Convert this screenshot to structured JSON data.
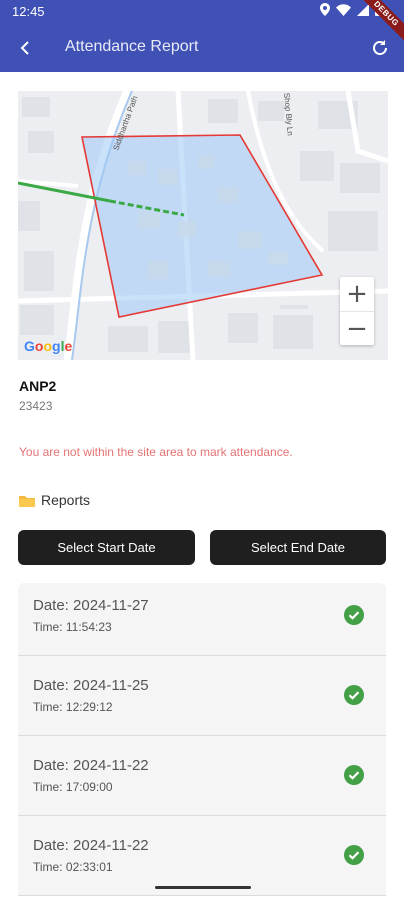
{
  "status_bar": {
    "time": "12:45"
  },
  "app_bar": {
    "title": "Attendance Report",
    "debug_label": "DEBUG"
  },
  "map": {
    "street_labels": [
      "Siddhartha Path",
      "Shop Bly Ln"
    ],
    "zoom_in_label": "+",
    "zoom_out_label": "−",
    "google_letters": [
      "G",
      "o",
      "o",
      "g",
      "l",
      "e"
    ]
  },
  "site": {
    "name": "ANP2",
    "code": "23423"
  },
  "warning": "You are not within the site area to mark attendance.",
  "reports": {
    "heading": "Reports",
    "start_date_label": "Select Start Date",
    "end_date_label": "Select End Date",
    "items": [
      {
        "date": "Date: 2024-11-27",
        "time": "Time: 11:54:23"
      },
      {
        "date": "Date: 2024-11-25",
        "time": "Time: 12:29:12"
      },
      {
        "date": "Date: 2024-11-22",
        "time": "Time: 17:09:00"
      },
      {
        "date": "Date: 2024-11-22",
        "time": "Time: 02:33:01"
      }
    ]
  },
  "colors": {
    "app_bar": "#3f51b5",
    "warning": "#e57373",
    "check": "#43a047",
    "button": "#1f1f1f"
  }
}
